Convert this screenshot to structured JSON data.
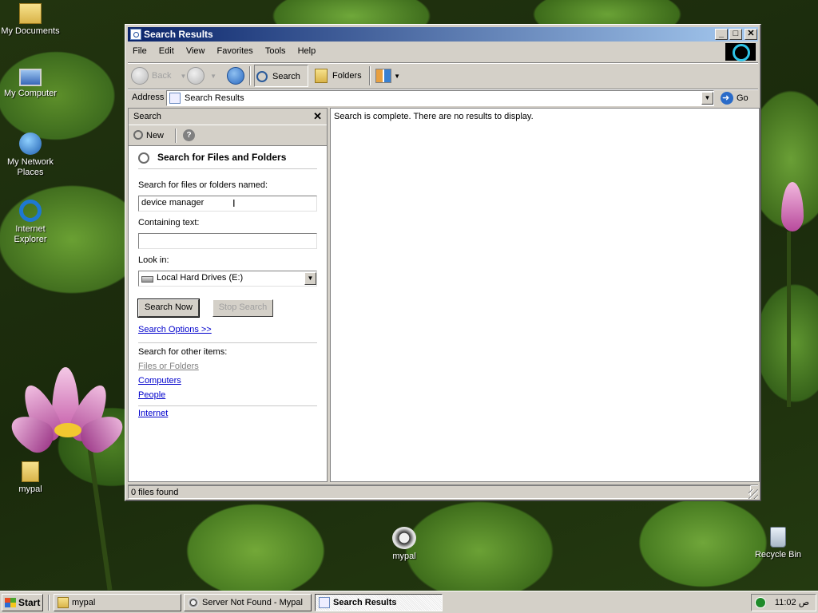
{
  "desktop": {
    "icons": [
      {
        "label": "My Documents"
      },
      {
        "label": "My Computer"
      },
      {
        "label": "My Network Places"
      },
      {
        "label": "Internet Explorer"
      },
      {
        "label": "mypal"
      },
      {
        "label": "mypal"
      },
      {
        "label": "Recycle Bin"
      }
    ]
  },
  "window": {
    "title": "Search Results",
    "controls": {
      "minimize": "_",
      "maximize": "□",
      "close": "✕"
    },
    "menu": [
      "File",
      "Edit",
      "View",
      "Favorites",
      "Tools",
      "Help"
    ],
    "toolbar": {
      "back": "Back",
      "search": "Search",
      "folders": "Folders"
    },
    "address": {
      "label": "Address",
      "value": "Search Results",
      "go": "Go"
    },
    "search_pane": {
      "title": "Search",
      "close": "✕",
      "new": "New",
      "heading": "Search for Files and Folders",
      "name_label": "Search for files or folders named:",
      "name_value": "device manager",
      "text_label": "Containing text:",
      "text_value": "",
      "lookin_label": "Look in:",
      "lookin_value": "Local Hard Drives (E:)",
      "search_now": "Search Now",
      "stop_search": "Stop Search",
      "options_link": "Search Options >>",
      "other_label": "Search for other items:",
      "other_links": [
        "Files or Folders",
        "Computers",
        "People"
      ],
      "internet": "Internet"
    },
    "results": {
      "message": "Search is complete. There are no results to display."
    },
    "status": "0 files found"
  },
  "taskbar": {
    "start": "Start",
    "buttons": [
      {
        "label": "mypal",
        "active": false
      },
      {
        "label": "Server Not Found - Mypal",
        "active": false
      },
      {
        "label": "Search Results",
        "active": true
      }
    ],
    "clock": "11:02 ص"
  }
}
